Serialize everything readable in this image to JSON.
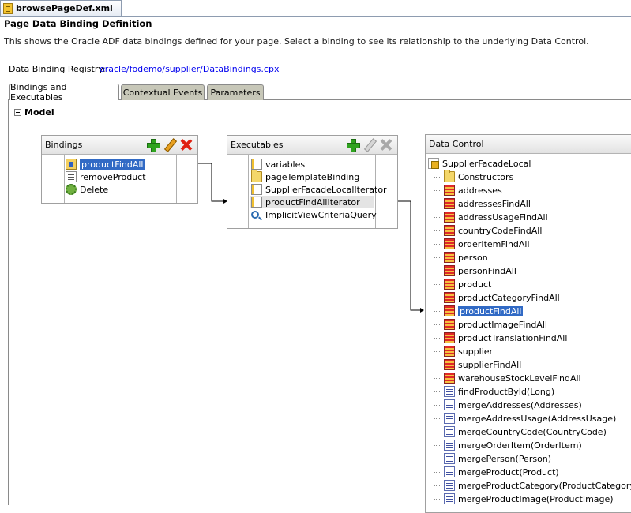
{
  "file_tab": {
    "label": "browsePageDef.xml",
    "icon": "xml-file-icon"
  },
  "header": {
    "title": "Page Data Binding Definition",
    "description": "This shows the Oracle ADF data bindings defined for your page. Select a binding to see its relationship to the underlying Data Control."
  },
  "registry": {
    "label": "Data Binding Registry:",
    "link": "oracle/fodemo/supplier/DataBindings.cpx"
  },
  "tabs": [
    {
      "label": "Bindings and Executables",
      "active": true
    },
    {
      "label": "Contextual Events",
      "active": false
    },
    {
      "label": "Parameters",
      "active": false
    }
  ],
  "section": {
    "title": "Model",
    "expanded": true
  },
  "bindings_panel": {
    "title": "Bindings",
    "items": [
      {
        "label": "productFindAll",
        "icon": "tree-binding-icon",
        "selected": true
      },
      {
        "label": "removeProduct",
        "icon": "method-binding-icon"
      },
      {
        "label": "Delete",
        "icon": "action-gear-icon"
      }
    ]
  },
  "executables_panel": {
    "title": "Executables",
    "items": [
      {
        "label": "variables",
        "icon": "variables-icon"
      },
      {
        "label": "pageTemplateBinding",
        "icon": "page-template-icon"
      },
      {
        "label": "SupplierFacadeLocalIterator",
        "icon": "iterator-icon"
      },
      {
        "label": "productFindAllIterator",
        "icon": "iterator-icon",
        "highlighted": true
      },
      {
        "label": "ImplicitViewCriteriaQuery",
        "icon": "search-icon"
      }
    ]
  },
  "data_control_panel": {
    "title": "Data Control",
    "root": {
      "label": "SupplierFacadeLocal",
      "icon": "data-control-icon"
    },
    "items": [
      {
        "label": "Constructors",
        "icon": "folder-icon"
      },
      {
        "label": "addresses",
        "icon": "collection-icon"
      },
      {
        "label": "addressesFindAll",
        "icon": "collection-icon"
      },
      {
        "label": "addressUsageFindAll",
        "icon": "collection-icon"
      },
      {
        "label": "countryCodeFindAll",
        "icon": "collection-icon"
      },
      {
        "label": "orderItemFindAll",
        "icon": "collection-icon"
      },
      {
        "label": "person",
        "icon": "collection-icon"
      },
      {
        "label": "personFindAll",
        "icon": "collection-icon"
      },
      {
        "label": "product",
        "icon": "collection-icon"
      },
      {
        "label": "productCategoryFindAll",
        "icon": "collection-icon"
      },
      {
        "label": "productFindAll",
        "icon": "collection-icon",
        "selected": true
      },
      {
        "label": "productImageFindAll",
        "icon": "collection-icon"
      },
      {
        "label": "productTranslationFindAll",
        "icon": "collection-icon"
      },
      {
        "label": "supplier",
        "icon": "collection-icon"
      },
      {
        "label": "supplierFindAll",
        "icon": "collection-icon"
      },
      {
        "label": "warehouseStockLevelFindAll",
        "icon": "collection-icon"
      },
      {
        "label": "findProductById(Long)",
        "icon": "method-icon"
      },
      {
        "label": "mergeAddresses(Addresses)",
        "icon": "method-icon"
      },
      {
        "label": "mergeAddressUsage(AddressUsage)",
        "icon": "method-icon"
      },
      {
        "label": "mergeCountryCode(CountryCode)",
        "icon": "method-icon"
      },
      {
        "label": "mergeOrderItem(OrderItem)",
        "icon": "method-icon"
      },
      {
        "label": "mergePerson(Person)",
        "icon": "method-icon"
      },
      {
        "label": "mergeProduct(Product)",
        "icon": "method-icon"
      },
      {
        "label": "mergeProductCategory(ProductCategory)",
        "icon": "method-icon"
      },
      {
        "label": "mergeProductImage(ProductImage)",
        "icon": "method-icon"
      }
    ]
  },
  "colors": {
    "selection": "#316ac5",
    "link": "#0000ee",
    "add": "#2fa31f",
    "delete": "#e02010"
  }
}
